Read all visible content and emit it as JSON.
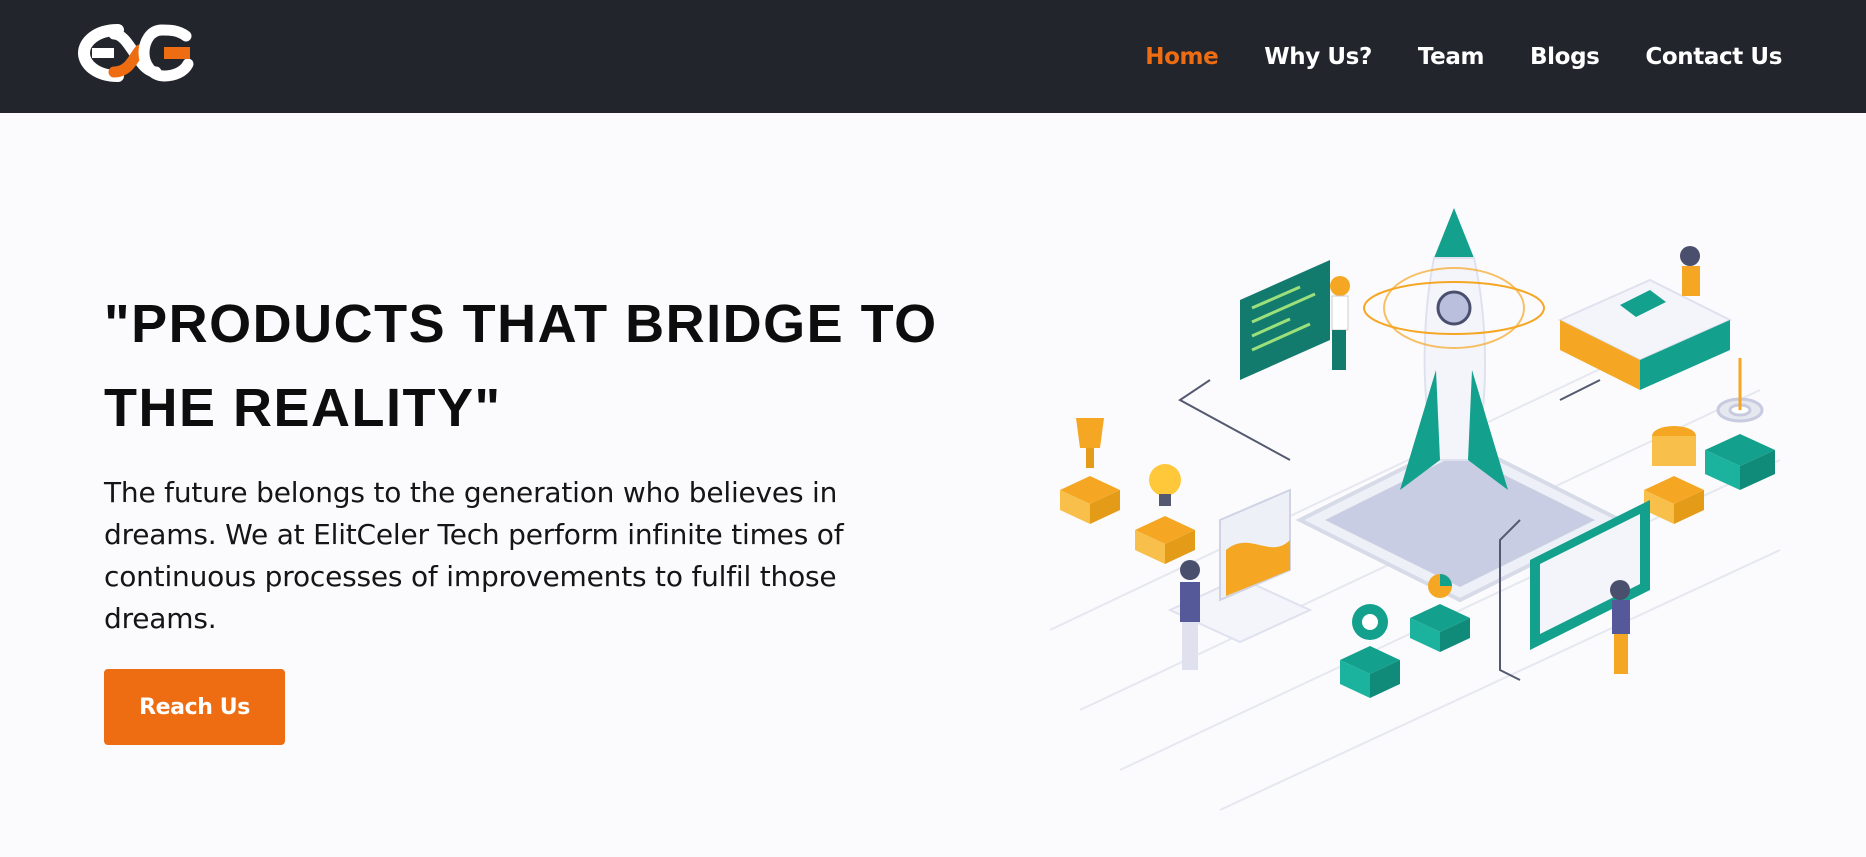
{
  "brand": {
    "logo_text": "EC",
    "accent": "#ee6d12",
    "nav_bg": "#22252c"
  },
  "nav": {
    "items": [
      {
        "label": "Home",
        "active": true
      },
      {
        "label": "Why Us?",
        "active": false
      },
      {
        "label": "Team",
        "active": false
      },
      {
        "label": "Blogs",
        "active": false
      },
      {
        "label": "Contact Us",
        "active": false
      }
    ]
  },
  "hero": {
    "title_line1": "\"PRODUCTS THAT BRIDGE TO",
    "title_line2": "THE REALITY\"",
    "description": "The future belongs to the generation who believes in dreams. We at ElitCeler Tech perform infinite times of continuous processes of improvements to fulfil those dreams.",
    "cta_label": "Reach Us"
  },
  "illustration": {
    "icons": [
      "rocket-icon",
      "trophy-icon",
      "lightbulb-icon",
      "gear-icon",
      "target-icon",
      "coin-icon",
      "laptop-icon",
      "chart-icon"
    ]
  }
}
